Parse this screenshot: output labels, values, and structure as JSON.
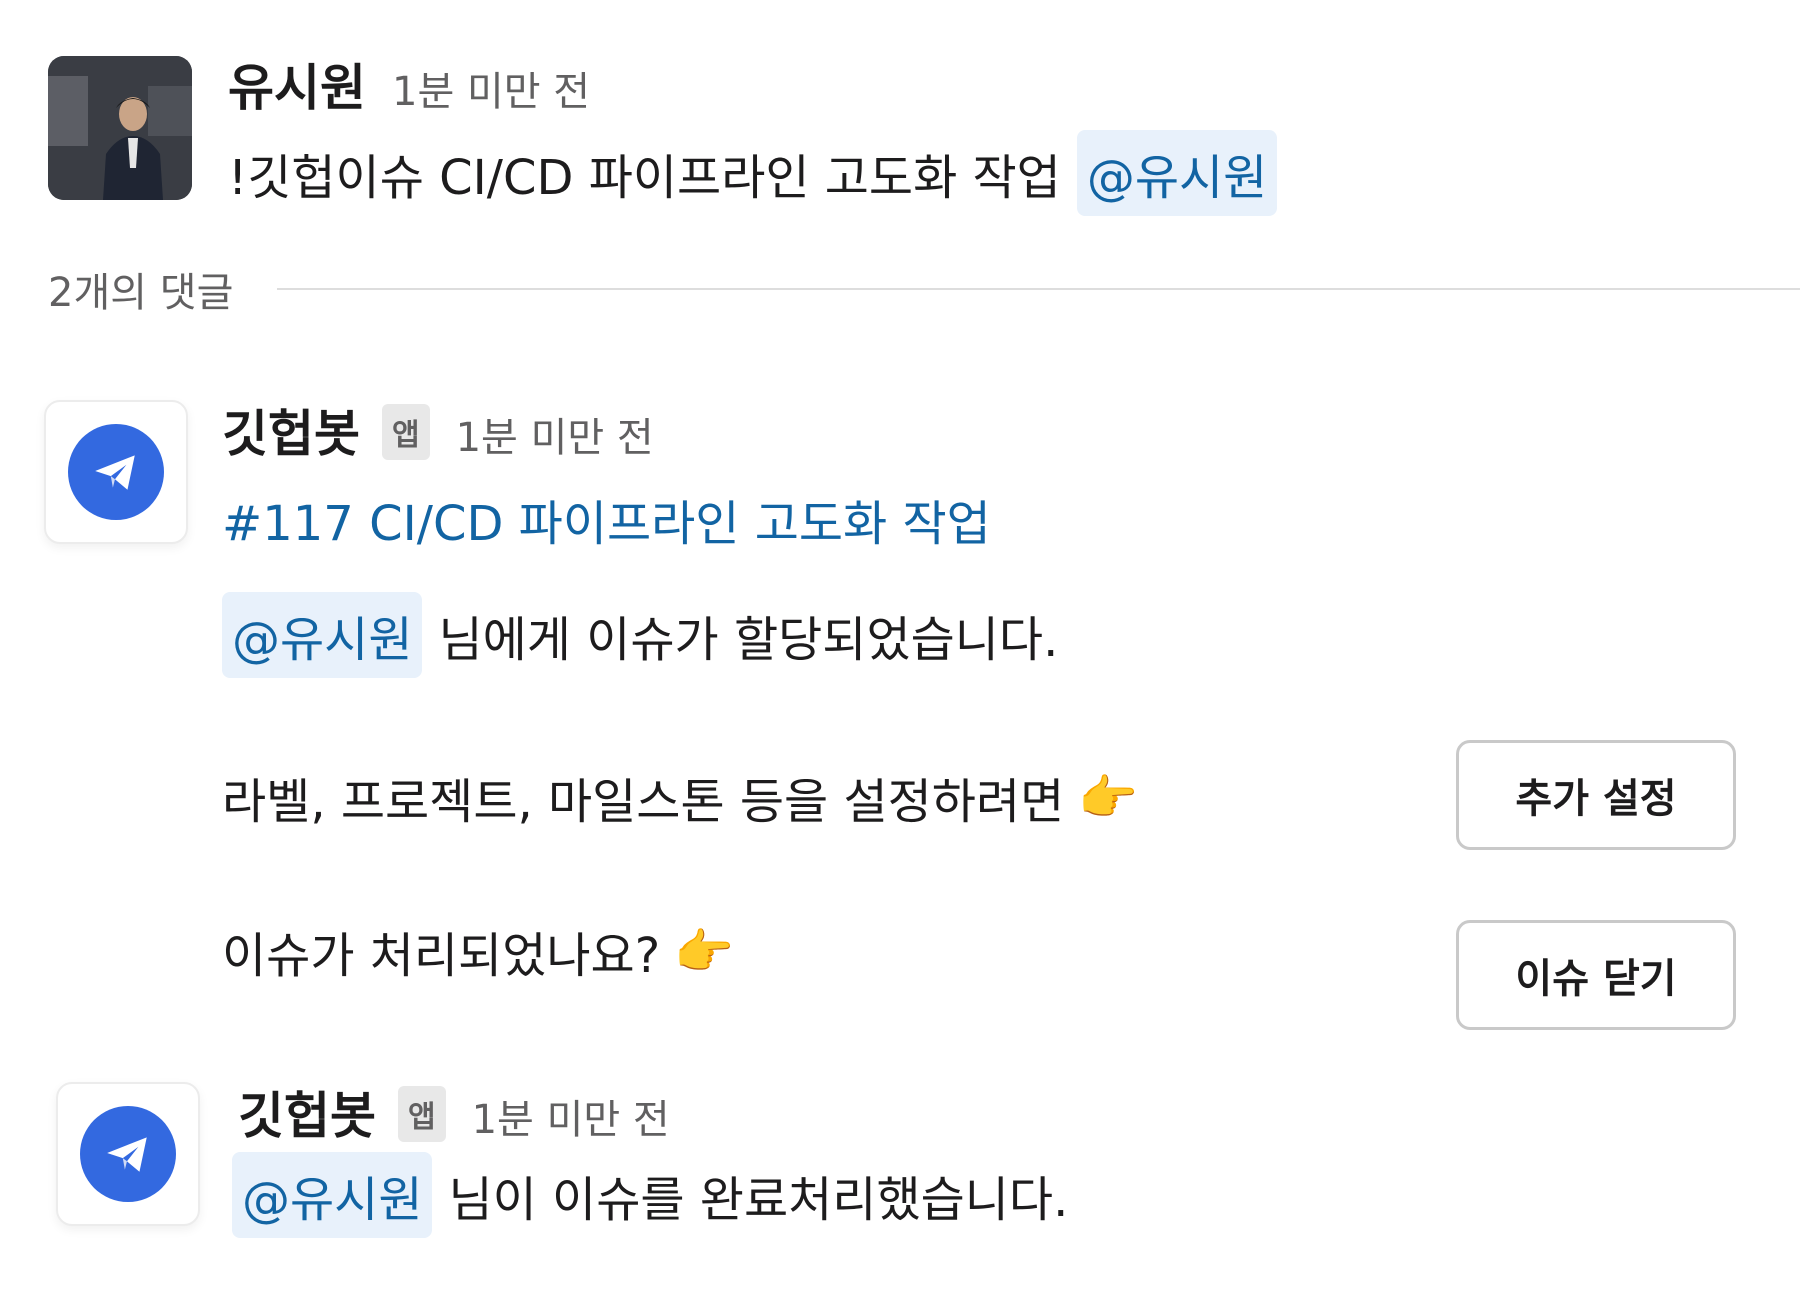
{
  "thread": {
    "parent": {
      "author": "유시원",
      "time": "1분 미만 전",
      "text": "!깃헙이슈 CI/CD 파이프라인 고도화 작업",
      "mention": "@유시원"
    },
    "reply_count_label": "2개의 댓글",
    "replies": [
      {
        "author": "깃헙봇",
        "badge": "앱",
        "time": "1분 미만 전",
        "issue_link": "#117 CI/CD 파이프라인 고도화 작업",
        "assign_mention": "@유시원",
        "assign_text": "님에게 이슈가 할당되었습니다.",
        "settings_prompt": "라벨, 프로젝트, 마일스톤 등을 설정하려면",
        "settings_button": "추가 설정",
        "close_prompt": "이슈가 처리되었나요?",
        "close_button": "이슈 닫기",
        "pointer_emoji": "👉"
      },
      {
        "author": "깃헙봇",
        "badge": "앱",
        "time": "1분 미만 전",
        "complete_mention": "@유시원",
        "complete_text": "님이 이슈를 완료처리했습니다."
      }
    ]
  },
  "icons": {
    "bot_icon": "paper-plane-icon",
    "pointer": "pointing-right-emoji"
  },
  "colors": {
    "link": "#1264a3",
    "mention_bg": "#e8f1fb",
    "bot_circle": "#3369e0",
    "badge_bg": "#e8e8e8"
  }
}
